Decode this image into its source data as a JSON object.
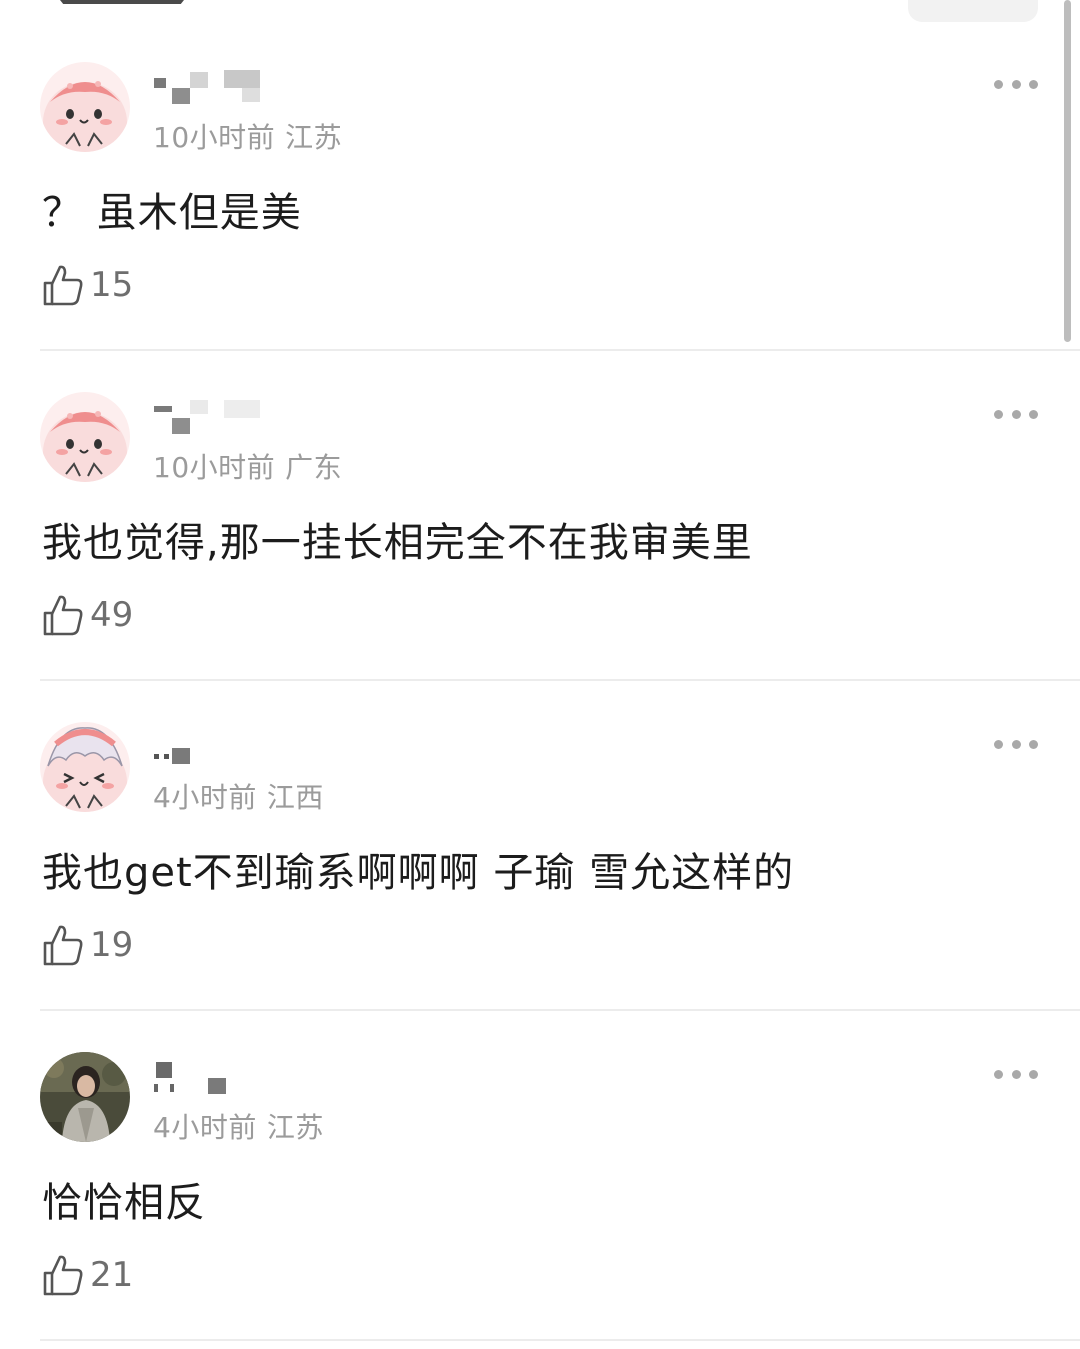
{
  "comments": [
    {
      "time": "10小时前",
      "location": "江苏",
      "text": "？ 虽木但是美",
      "likes": "15",
      "avatar_icon": "cute-pink-creature-avatar"
    },
    {
      "time": "10小时前",
      "location": "广东",
      "text": "我也觉得,那一挂长相完全不在我审美里",
      "likes": "49",
      "avatar_icon": "cute-pink-creature-avatar"
    },
    {
      "time": "4小时前",
      "location": "江西",
      "text": "我也get不到瑜系啊啊啊 子瑜 雪允这样的",
      "likes": "19",
      "avatar_icon": "cute-pink-creature-with-hair-avatar"
    },
    {
      "time": "4小时前",
      "location": "江苏",
      "text": "恰恰相反",
      "likes": "21",
      "avatar_icon": "user-photo-avatar"
    }
  ],
  "icons": {
    "like": "thumbs-up-icon",
    "more": "more-dots-icon"
  },
  "colors": {
    "meta": "#9b9b9b",
    "text": "#1c1c1c",
    "divider": "#ececec",
    "avatar_pink": "#f7cfd0"
  }
}
